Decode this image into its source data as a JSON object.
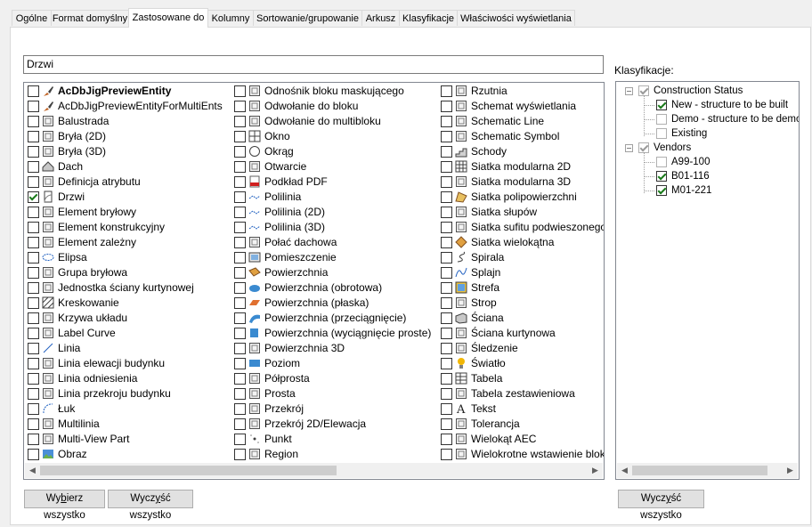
{
  "tabs": [
    {
      "label": "Ogólne",
      "active": false
    },
    {
      "label": "Format domyślny",
      "active": false
    },
    {
      "label": "Zastosowane do",
      "active": true
    },
    {
      "label": "Kolumny",
      "active": false
    },
    {
      "label": "Sortowanie/grupowanie",
      "active": false
    },
    {
      "label": "Arkusz",
      "active": false
    },
    {
      "label": "Klasyfikacje",
      "active": false
    },
    {
      "label": "Właściwości wyświetlania",
      "active": false
    }
  ],
  "filter": {
    "value": "Drzwi"
  },
  "objects": {
    "col1": [
      {
        "label": "AcDbJigPreviewEntity",
        "checked": false,
        "bold": true,
        "icon": "brush-icon"
      },
      {
        "label": "AcDbJigPreviewEntityForMultiEnts",
        "checked": false,
        "icon": "brush-icon"
      },
      {
        "label": "Balustrada",
        "checked": false,
        "icon": "railing-icon"
      },
      {
        "label": "Bryła (2D)",
        "checked": false,
        "icon": "mass-2d-icon"
      },
      {
        "label": "Bryła (3D)",
        "checked": false,
        "icon": "mass-3d-icon"
      },
      {
        "label": "Dach",
        "checked": false,
        "icon": "roof-icon"
      },
      {
        "label": "Definicja atrybutu",
        "checked": false,
        "icon": "attribute-icon"
      },
      {
        "label": "Drzwi",
        "checked": true,
        "icon": "door-icon"
      },
      {
        "label": "Element bryłowy",
        "checked": false,
        "icon": "mass-element-icon"
      },
      {
        "label": "Element konstrukcyjny",
        "checked": false,
        "icon": "structural-icon"
      },
      {
        "label": "Element zależny",
        "checked": false,
        "icon": "dependent-icon"
      },
      {
        "label": "Elipsa",
        "checked": false,
        "icon": "ellipse-icon"
      },
      {
        "label": "Grupa bryłowa",
        "checked": false,
        "icon": "mass-group-icon"
      },
      {
        "label": "Jednostka ściany kurtynowej",
        "checked": false,
        "icon": "curtain-unit-icon"
      },
      {
        "label": "Kreskowanie",
        "checked": false,
        "icon": "hatch-icon"
      },
      {
        "label": "Krzywa układu",
        "checked": false,
        "icon": "layout-curve-icon"
      },
      {
        "label": "Label Curve",
        "checked": false,
        "icon": "label-curve-icon"
      },
      {
        "label": "Linia",
        "checked": false,
        "icon": "line-icon"
      },
      {
        "label": "Linia elewacji budynku",
        "checked": false,
        "icon": "elevation-line-icon"
      },
      {
        "label": "Linia odniesienia",
        "checked": false,
        "icon": "leader-icon"
      },
      {
        "label": "Linia przekroju budynku",
        "checked": false,
        "icon": "section-line-icon"
      },
      {
        "label": "Łuk",
        "checked": false,
        "icon": "arc-icon"
      },
      {
        "label": "Multilinia",
        "checked": false,
        "icon": "multiline-icon"
      },
      {
        "label": "Multi-View Part",
        "checked": false,
        "icon": "multiview-icon"
      },
      {
        "label": "Obraz",
        "checked": false,
        "icon": "image-icon"
      }
    ],
    "col2": [
      {
        "label": "Odnośnik bloku maskującego",
        "checked": false,
        "icon": "mask-block-icon"
      },
      {
        "label": "Odwołanie do bloku",
        "checked": false,
        "icon": "block-ref-icon"
      },
      {
        "label": "Odwołanie do multibloku",
        "checked": false,
        "icon": "multiblock-icon"
      },
      {
        "label": "Okno",
        "checked": false,
        "icon": "window-icon"
      },
      {
        "label": "Okrąg",
        "checked": false,
        "icon": "circle-icon"
      },
      {
        "label": "Otwarcie",
        "checked": false,
        "icon": "opening-icon"
      },
      {
        "label": "Podkład PDF",
        "checked": false,
        "icon": "pdf-icon"
      },
      {
        "label": "Polilinia",
        "checked": false,
        "icon": "polyline-icon"
      },
      {
        "label": "Polilinia (2D)",
        "checked": false,
        "icon": "polyline-icon"
      },
      {
        "label": "Polilinia (3D)",
        "checked": false,
        "icon": "polyline-icon"
      },
      {
        "label": "Połać dachowa",
        "checked": false,
        "icon": "roof-slab-icon"
      },
      {
        "label": "Pomieszczenie",
        "checked": false,
        "icon": "space-icon"
      },
      {
        "label": "Powierzchnia",
        "checked": false,
        "icon": "surface-icon"
      },
      {
        "label": "Powierzchnia (obrotowa)",
        "checked": false,
        "icon": "surface-revolve-icon"
      },
      {
        "label": "Powierzchnia (płaska)",
        "checked": false,
        "icon": "surface-planar-icon"
      },
      {
        "label": "Powierzchnia (przeciągnięcie)",
        "checked": false,
        "icon": "surface-sweep-icon"
      },
      {
        "label": "Powierzchnia (wyciągnięcie proste)",
        "checked": false,
        "icon": "surface-extrude-icon"
      },
      {
        "label": "Powierzchnia 3D",
        "checked": false,
        "icon": "surface-3d-icon"
      },
      {
        "label": "Poziom",
        "checked": false,
        "icon": "level-icon"
      },
      {
        "label": "Półprosta",
        "checked": false,
        "icon": "ray-icon"
      },
      {
        "label": "Prosta",
        "checked": false,
        "icon": "xline-icon"
      },
      {
        "label": "Przekrój",
        "checked": false,
        "icon": "section-icon"
      },
      {
        "label": "Przekrój 2D/Elewacja",
        "checked": false,
        "icon": "section-2d-icon"
      },
      {
        "label": "Punkt",
        "checked": false,
        "icon": "point-icon"
      },
      {
        "label": "Region",
        "checked": false,
        "icon": "region-icon"
      }
    ],
    "col3": [
      {
        "label": "Rzutnia",
        "checked": false,
        "icon": "viewport-icon"
      },
      {
        "label": "Schemat wyświetlania",
        "checked": false,
        "icon": "display-schema-icon"
      },
      {
        "label": "Schematic Line",
        "checked": false,
        "icon": "schematic-line-icon"
      },
      {
        "label": "Schematic Symbol",
        "checked": false,
        "icon": "schematic-symbol-icon"
      },
      {
        "label": "Schody",
        "checked": false,
        "icon": "stair-icon"
      },
      {
        "label": "Siatka modularna 2D",
        "checked": false,
        "icon": "grid-2d-icon"
      },
      {
        "label": "Siatka modularna 3D",
        "checked": false,
        "icon": "grid-3d-icon"
      },
      {
        "label": "Siatka polipowierzchni",
        "checked": false,
        "icon": "polyface-icon"
      },
      {
        "label": "Siatka słupów",
        "checked": false,
        "icon": "column-grid-icon"
      },
      {
        "label": "Siatka sufitu podwieszonego",
        "checked": false,
        "icon": "ceiling-grid-icon"
      },
      {
        "label": "Siatka wielokątna",
        "checked": false,
        "icon": "polygon-mesh-icon"
      },
      {
        "label": "Spirala",
        "checked": false,
        "icon": "helix-icon"
      },
      {
        "label": "Splajn",
        "checked": false,
        "icon": "spline-icon"
      },
      {
        "label": "Strefa",
        "checked": false,
        "icon": "zone-icon"
      },
      {
        "label": "Strop",
        "checked": false,
        "icon": "slab-icon"
      },
      {
        "label": "Ściana",
        "checked": false,
        "icon": "wall-icon"
      },
      {
        "label": "Ściana kurtynowa",
        "checked": false,
        "icon": "curtain-wall-icon"
      },
      {
        "label": "Śledzenie",
        "checked": false,
        "icon": "trace-icon"
      },
      {
        "label": "Światło",
        "checked": false,
        "icon": "light-icon"
      },
      {
        "label": "Tabela",
        "checked": false,
        "icon": "table-icon"
      },
      {
        "label": "Tabela zestawieniowa",
        "checked": false,
        "icon": "schedule-table-icon"
      },
      {
        "label": "Tekst",
        "checked": false,
        "icon": "text-icon"
      },
      {
        "label": "Tolerancja",
        "checked": false,
        "icon": "tolerance-icon"
      },
      {
        "label": "Wielokąt AEC",
        "checked": false,
        "icon": "aec-polygon-icon"
      },
      {
        "label": "Wielokrotne wstawienie bloku",
        "checked": false,
        "icon": "minsert-icon"
      }
    ]
  },
  "classifications": {
    "label": "Klasyfikacje:",
    "groups": [
      {
        "label": "Construction Status",
        "state": "partial",
        "children": [
          {
            "label": "New - structure to be built",
            "checked": true
          },
          {
            "label": "Demo - structure to be demolished",
            "checked": false
          },
          {
            "label": "Existing",
            "checked": false
          }
        ]
      },
      {
        "label": "Vendors",
        "state": "partial",
        "children": [
          {
            "label": "A99-100",
            "checked": false
          },
          {
            "label": "B01-116",
            "checked": true
          },
          {
            "label": "M01-221",
            "checked": true
          }
        ]
      }
    ]
  },
  "buttons": {
    "select_all_pre": "Wy",
    "select_all_acc": "b",
    "select_all_post": "ierz wszystko",
    "clear_all_pre": "Wycz",
    "clear_all_acc": "y",
    "clear_all_post": "ść wszystko",
    "clear_class_pre": "Wycz",
    "clear_class_acc": "y",
    "clear_class_post": "ść wszystko"
  },
  "colors": {
    "check": "#1a7a1a",
    "accent": "#0078d7"
  }
}
